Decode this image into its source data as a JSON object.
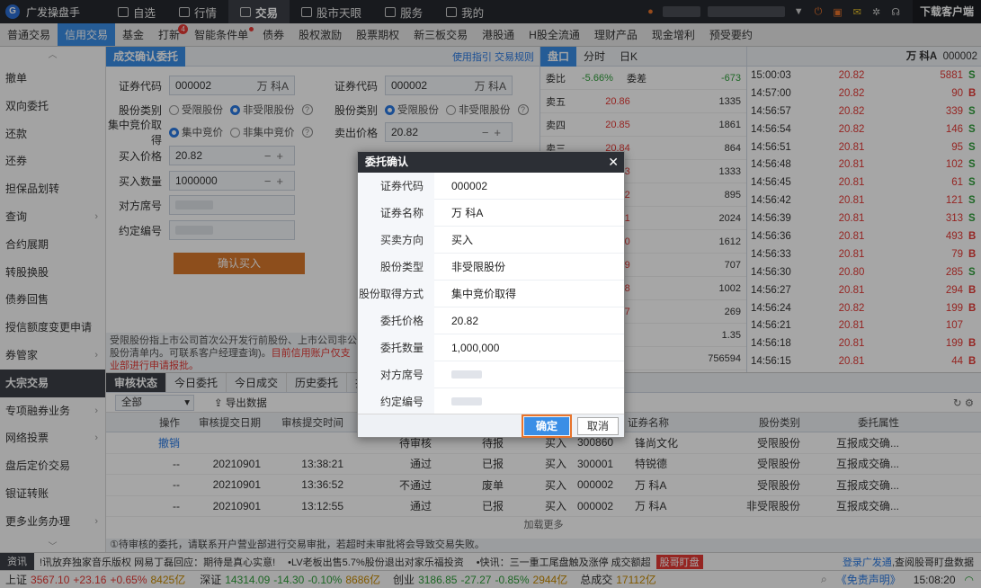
{
  "app": {
    "name": "广发操盘手",
    "download": "下载客户端"
  },
  "topnav": [
    {
      "label": "自选"
    },
    {
      "label": "行情"
    },
    {
      "label": "交易"
    },
    {
      "label": "股市天眼"
    },
    {
      "label": "服务"
    },
    {
      "label": "我的"
    }
  ],
  "subtabs": [
    {
      "label": "普通交易"
    },
    {
      "label": "信用交易"
    },
    {
      "label": "基金"
    },
    {
      "label": "打新",
      "badge": "4"
    },
    {
      "label": "智能条件单"
    },
    {
      "label": "债券"
    },
    {
      "label": "股权激励"
    },
    {
      "label": "股票期权"
    },
    {
      "label": "新三板交易"
    },
    {
      "label": "港股通"
    },
    {
      "label": "H股全流通"
    },
    {
      "label": "理财产品"
    },
    {
      "label": "现金增利"
    },
    {
      "label": "预受要约"
    }
  ],
  "sidebar": [
    {
      "label": "撤单"
    },
    {
      "label": "双向委托"
    },
    {
      "label": "还款"
    },
    {
      "label": "还券"
    },
    {
      "label": "担保品划转"
    },
    {
      "label": "查询",
      "chev": "›"
    },
    {
      "label": "合约展期"
    },
    {
      "label": "转股换股"
    },
    {
      "label": "债券回售"
    },
    {
      "label": "授信额度变更申请"
    },
    {
      "label": "券管家",
      "chev": "›"
    },
    {
      "label": "大宗交易"
    },
    {
      "label": "专项融券业务",
      "chev": "›"
    },
    {
      "label": "网络投票",
      "chev": "›"
    },
    {
      "label": "盘后定价交易"
    },
    {
      "label": "银证转账"
    },
    {
      "label": "更多业务办理",
      "chev": "›"
    }
  ],
  "form": {
    "title": "成交确认委托",
    "links": "使用指引 交易规则",
    "left": {
      "code_label": "证券代码",
      "code": "000002",
      "name": "万 科A",
      "type_label": "股份类别",
      "type_opt1": "受限股份",
      "type_opt2": "非受限股份",
      "acq_label": "集中竞价取得",
      "acq_opt1": "集中竞价",
      "acq_opt2": "非集中竞价",
      "price_label": "买入价格",
      "price": "20.82",
      "qty_label": "买入数量",
      "qty": "1000000",
      "seat_label": "对方席号",
      "contract_label": "约定编号",
      "submit": "确认买入"
    },
    "right": {
      "code_label": "证券代码",
      "code": "000002",
      "name": "万 科A",
      "type_label": "股份类别",
      "type_opt1": "受限股份",
      "type_opt2": "非受限股份",
      "price_label": "卖出价格",
      "price": "20.82"
    },
    "note1": "受限股份指上市公司首次公开发行前股份、上市公司非公",
    "note2": "股份清单内。可联系客户经理查询)。",
    "note2_red": "目前信用账户仅支",
    "note3": "业部进行申请报批。"
  },
  "quote": {
    "tabs": [
      "盘口",
      "分时",
      "日K"
    ],
    "header": {
      "a": "委比",
      "b": "-5.66%",
      "c": "委差",
      "d": "-673"
    },
    "rows": [
      {
        "n": "卖五",
        "p": "20.86",
        "v": "1335"
      },
      {
        "n": "卖四",
        "p": "20.85",
        "v": "1861"
      },
      {
        "n": "卖三",
        "p": "20.84",
        "v": "864"
      },
      {
        "n": "",
        "p": "20.83",
        "v": "1333"
      },
      {
        "n": "",
        "p": "20.82",
        "v": "895"
      },
      {
        "n": "",
        "p": "20.81",
        "v": "2024"
      },
      {
        "n": "",
        "p": "20.80",
        "v": "1612"
      },
      {
        "n": "",
        "p": "20.79",
        "v": "707"
      },
      {
        "n": "",
        "p": "20.78",
        "v": "1002"
      },
      {
        "n": "",
        "p": "20.77",
        "v": "269"
      }
    ],
    "bottom": [
      {
        "a": "%",
        "b": "量比",
        "c": "1.35"
      },
      {
        "a": "96",
        "b": "外盘",
        "c": "756594"
      }
    ]
  },
  "ticks": {
    "stock": "万 科A",
    "code": "000002",
    "rows": [
      {
        "t": "15:00:03",
        "p": "20.82",
        "v": "5881",
        "s": "S"
      },
      {
        "t": "14:57:00",
        "p": "20.82",
        "v": "90",
        "s": "B"
      },
      {
        "t": "14:56:57",
        "p": "20.82",
        "v": "339",
        "s": "S"
      },
      {
        "t": "14:56:54",
        "p": "20.82",
        "v": "146",
        "s": "S"
      },
      {
        "t": "14:56:51",
        "p": "20.81",
        "v": "95",
        "s": "S"
      },
      {
        "t": "14:56:48",
        "p": "20.81",
        "v": "102",
        "s": "S"
      },
      {
        "t": "14:56:45",
        "p": "20.81",
        "v": "61",
        "s": "S"
      },
      {
        "t": "14:56:42",
        "p": "20.81",
        "v": "121",
        "s": "S"
      },
      {
        "t": "14:56:39",
        "p": "20.81",
        "v": "313",
        "s": "S"
      },
      {
        "t": "14:56:36",
        "p": "20.81",
        "v": "493",
        "s": "B"
      },
      {
        "t": "14:56:33",
        "p": "20.81",
        "v": "79",
        "s": "B"
      },
      {
        "t": "14:56:30",
        "p": "20.80",
        "v": "285",
        "s": "S"
      },
      {
        "t": "14:56:27",
        "p": "20.81",
        "v": "294",
        "s": "B"
      },
      {
        "t": "14:56:24",
        "p": "20.82",
        "v": "199",
        "s": "B"
      },
      {
        "t": "14:56:21",
        "p": "20.81",
        "v": "107",
        "s": ""
      },
      {
        "t": "14:56:18",
        "p": "20.81",
        "v": "199",
        "s": "B"
      },
      {
        "t": "14:56:15",
        "p": "20.81",
        "v": "44",
        "s": "B"
      }
    ]
  },
  "bottom": {
    "tabs": [
      "审核状态",
      "今日委托",
      "今日成交",
      "历史委托",
      "持"
    ],
    "filter": "全部",
    "export": "导出数据",
    "headers": [
      "操作",
      "审核提交日期",
      "审核提交时间",
      "",
      "",
      "",
      "码",
      "证券名称",
      "股份类别",
      "委托属性"
    ],
    "rows": [
      {
        "op": "撤销",
        "date": "",
        "time": "",
        "st": "待审核",
        "st2": "待报",
        "dir": "买入",
        "code": "300860",
        "name": "锋尚文化",
        "cat": "受限股份",
        "prop": "互报成交确..."
      },
      {
        "op": "--",
        "date": "20210901",
        "time": "13:38:21",
        "st": "通过",
        "st2": "已报",
        "dir": "买入",
        "code": "300001",
        "name": "特锐德",
        "cat": "受限股份",
        "prop": "互报成交确..."
      },
      {
        "op": "--",
        "date": "20210901",
        "time": "13:36:52",
        "st": "不通过",
        "st2": "废单",
        "dir": "买入",
        "code": "000002",
        "name": "万 科A",
        "cat": "受限股份",
        "prop": "互报成交确..."
      },
      {
        "op": "--",
        "date": "20210901",
        "time": "13:12:55",
        "st": "通过",
        "st2": "已报",
        "dir": "买入",
        "code": "000002",
        "name": "万 科A",
        "cat": "非受限股份",
        "prop": "互报成交确..."
      }
    ],
    "more": "加载更多",
    "footnote": "①待审核的委托，请联系开户营业部进行交易审批，若超时未审批将会导致交易失败。"
  },
  "news": {
    "tag": "资讯",
    "t1": "!讯放弃独家音乐版权 网易丁磊回应：期待是真心实意!",
    "t2": "•LV老板出售5.7%股份退出对家乐福投资",
    "t3": "•快讯：三一重工尾盘触及涨停 成交额超",
    "red": "股哥盯盘",
    "lnk": "登录广发通",
    "t4": ",查阅股哥盯盘数据"
  },
  "status": {
    "sh": "上证",
    "sh_v": "3567.10",
    "sh_c": "+23.16",
    "sh_p": "+0.65%",
    "sh_a": "8425亿",
    "sz": "深证",
    "sz_v": "14314.09",
    "sz_c": "-14.30",
    "sz_p": "-0.10%",
    "sz_a": "8686亿",
    "cy": "创业",
    "cy_v": "3186.85",
    "cy_c": "-27.27",
    "cy_p": "-0.85%",
    "cy_a": "2944亿",
    "total": "总成交",
    "total_v": "17112亿",
    "disc": "《免责声明》",
    "time": "15:08:20"
  },
  "dialog": {
    "title": "委托确认",
    "rows": [
      {
        "k": "证券代码",
        "v": "000002"
      },
      {
        "k": "证券名称",
        "v": "万 科A"
      },
      {
        "k": "买卖方向",
        "v": "买入"
      },
      {
        "k": "股份类型",
        "v": "非受限股份"
      },
      {
        "k": "股份取得方式",
        "v": "集中竞价取得"
      },
      {
        "k": "委托价格",
        "v": "20.82"
      },
      {
        "k": "委托数量",
        "v": "1,000,000"
      },
      {
        "k": "对方席号",
        "v": ""
      },
      {
        "k": "约定编号",
        "v": ""
      }
    ],
    "ok": "确定",
    "cancel": "取消"
  }
}
